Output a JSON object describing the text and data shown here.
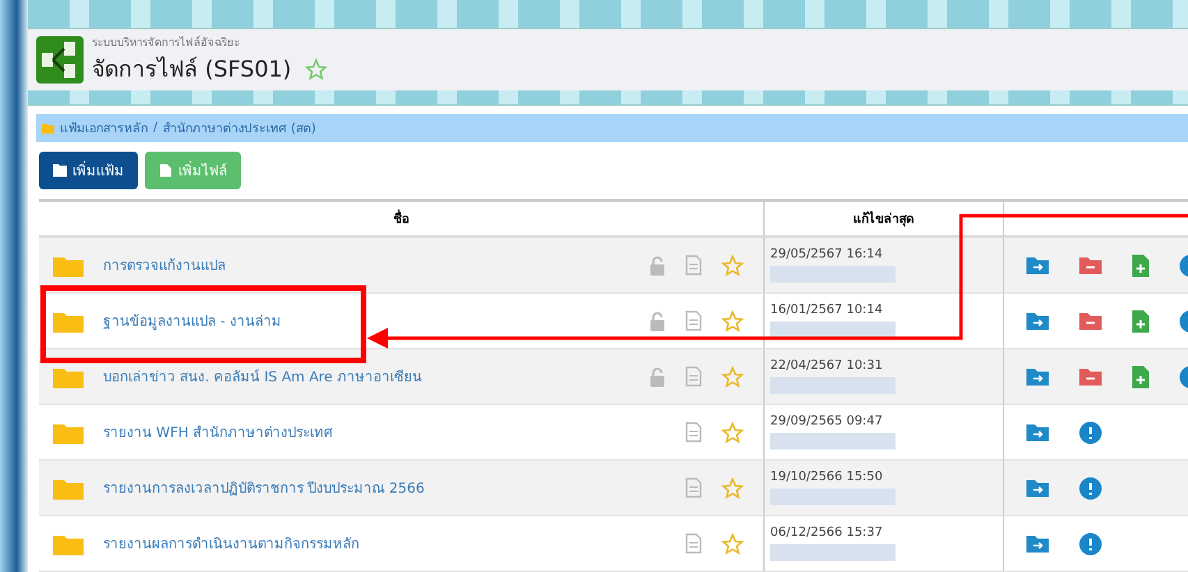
{
  "header": {
    "subtitle": "ระบบบริหารจัดการไฟล์อัจฉริยะ",
    "title": "จัดการไฟล์ (SFS01)",
    "favorite": false
  },
  "breadcrumb": [
    "แฟ้มเอกสารหลัก",
    "/",
    "สำนักภาษาต่างประเทศ (สต)"
  ],
  "buttons": [
    {
      "kind": "folder",
      "label": "เพิ่มแฟ้ม"
    },
    {
      "kind": "file",
      "label": "เพิ่มไฟล์"
    }
  ],
  "table": {
    "columns": [
      "ชื่อ",
      "แก้ไขล่าสุด"
    ],
    "rows": [
      {
        "name": "การตรวจแก้งานแปล",
        "icons": [
          {
            "kind": "lock"
          },
          {
            "kind": "document"
          },
          {
            "kind": "star"
          }
        ],
        "modified": "29/05/2567 16:14",
        "actions": [
          {
            "kind": "move"
          },
          {
            "kind": "delete"
          },
          {
            "kind": "add-file"
          },
          {
            "kind": "info"
          }
        ],
        "highlighted": false
      },
      {
        "name": "ฐานข้อมูลงานแปล - งานล่าม",
        "icons": [
          {
            "kind": "lock"
          },
          {
            "kind": "document"
          },
          {
            "kind": "star"
          }
        ],
        "modified": "16/01/2567 10:14",
        "actions": [
          {
            "kind": "move"
          },
          {
            "kind": "delete"
          },
          {
            "kind": "add-file"
          },
          {
            "kind": "info"
          }
        ],
        "highlighted": true
      },
      {
        "name": "บอกเล่าข่าว สนง. คอลัมน์ IS Am Are ภาษาอาเซียน",
        "icons": [
          {
            "kind": "lock"
          },
          {
            "kind": "document"
          },
          {
            "kind": "star"
          }
        ],
        "modified": "22/04/2567 10:31",
        "actions": [
          {
            "kind": "move"
          },
          {
            "kind": "delete"
          },
          {
            "kind": "add-file"
          },
          {
            "kind": "info"
          }
        ],
        "highlighted": false
      },
      {
        "name": "รายงาน WFH สำนักภาษาต่างประเทศ",
        "icons": [
          {
            "kind": "document"
          },
          {
            "kind": "star"
          }
        ],
        "modified": "29/09/2565 09:47",
        "actions": [
          {
            "kind": "move"
          },
          {
            "kind": "info"
          }
        ],
        "highlighted": false
      },
      {
        "name": "รายงานการลงเวลาปฏิบัติราชการ ปีงบประมาณ 2566",
        "icons": [
          {
            "kind": "document"
          },
          {
            "kind": "star"
          }
        ],
        "modified": "19/10/2566 15:50",
        "actions": [
          {
            "kind": "move"
          },
          {
            "kind": "info"
          }
        ],
        "highlighted": false
      },
      {
        "name": "รายงานผลการดำเนินงานตามกิจกรรมหลัก",
        "icons": [
          {
            "kind": "document"
          },
          {
            "kind": "star"
          }
        ],
        "modified": "06/12/2566 15:37",
        "actions": [
          {
            "kind": "move"
          },
          {
            "kind": "info"
          }
        ],
        "highlighted": false
      }
    ]
  }
}
